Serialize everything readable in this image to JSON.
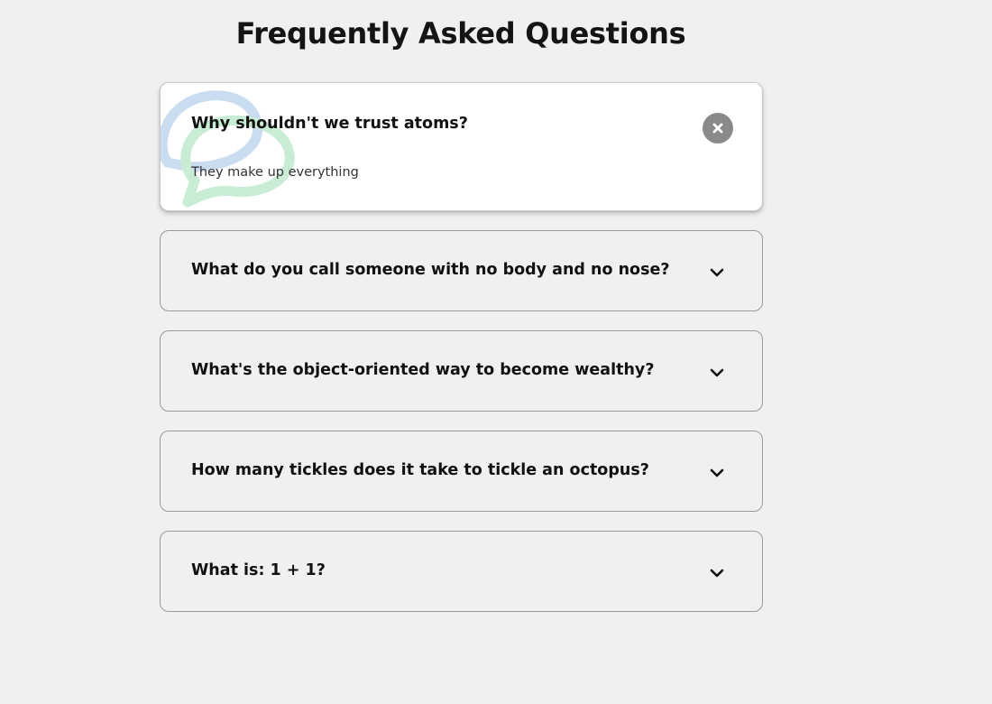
{
  "page": {
    "title": "Frequently Asked Questions"
  },
  "colors": {
    "background": "#f0f0f0",
    "active_card": "#ffffff",
    "close_button": "#8a8a8a",
    "bubble_blue": "#c9dcf0",
    "bubble_green": "#c8ecd4"
  },
  "faqs": [
    {
      "question": "Why shouldn't we trust atoms?",
      "answer": "They make up everything",
      "expanded": true,
      "toggle_icon": "close-icon"
    },
    {
      "question": "What do you call someone with no body and no nose?",
      "expanded": false,
      "toggle_icon": "chevron-down-icon"
    },
    {
      "question": "What's the object-oriented way to become wealthy?",
      "expanded": false,
      "toggle_icon": "chevron-down-icon"
    },
    {
      "question": "How many tickles does it take to tickle an octopus?",
      "expanded": false,
      "toggle_icon": "chevron-down-icon"
    },
    {
      "question": "What is: 1 + 1?",
      "expanded": false,
      "toggle_icon": "chevron-down-icon"
    }
  ]
}
